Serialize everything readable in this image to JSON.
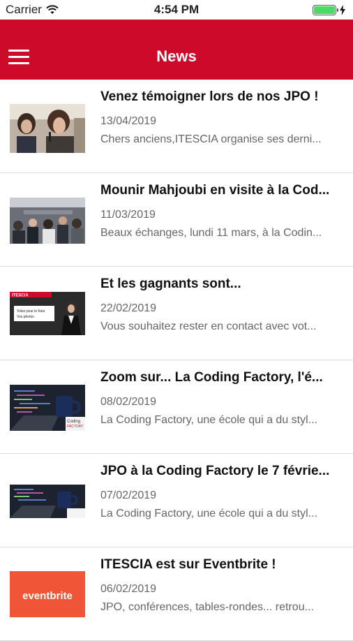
{
  "status_bar": {
    "carrier": "Carrier",
    "time": "4:54 PM",
    "battery_level": 1.0
  },
  "header": {
    "title": "News",
    "menu_icon": "hamburger-menu-icon"
  },
  "colors": {
    "brand": "#cd0a2a",
    "battery": "#4cd964"
  },
  "news": [
    {
      "title": "Venez témoigner lors de nos JPO !",
      "date": "13/04/2019",
      "excerpt": "Chers anciens,ITESCIA organise ses derni..."
    },
    {
      "title": "Mounir Mahjoubi en visite à la Cod...",
      "date": "11/03/2019",
      "excerpt": "Beaux échanges, lundi 11 mars, à la Codin..."
    },
    {
      "title": "Et les gagnants sont...",
      "date": "22/02/2019",
      "excerpt": "Vous souhaitez rester en contact avec vot...",
      "thumb_text": {
        "tag": "ITESCIA",
        "line1": "Votez pour le futur",
        "line2": "Vos photos"
      }
    },
    {
      "title": "Zoom sur... La Coding Factory, l'é...",
      "date": "08/02/2019",
      "excerpt": "La Coding Factory, une école qui a du styl...",
      "thumb_text": {
        "brand1": "Coding",
        "brand2": "FACTORY"
      }
    },
    {
      "title": "JPO à la Coding Factory le 7 févrie...",
      "date": "07/02/2019",
      "excerpt": "La Coding Factory, une école qui a du styl..."
    },
    {
      "title": "ITESCIA est sur Eventbrite !",
      "date": "06/02/2019",
      "excerpt": "JPO, conférences, tables-rondes... retrou...",
      "thumb_text": {
        "brand": "eventbrite"
      }
    }
  ]
}
